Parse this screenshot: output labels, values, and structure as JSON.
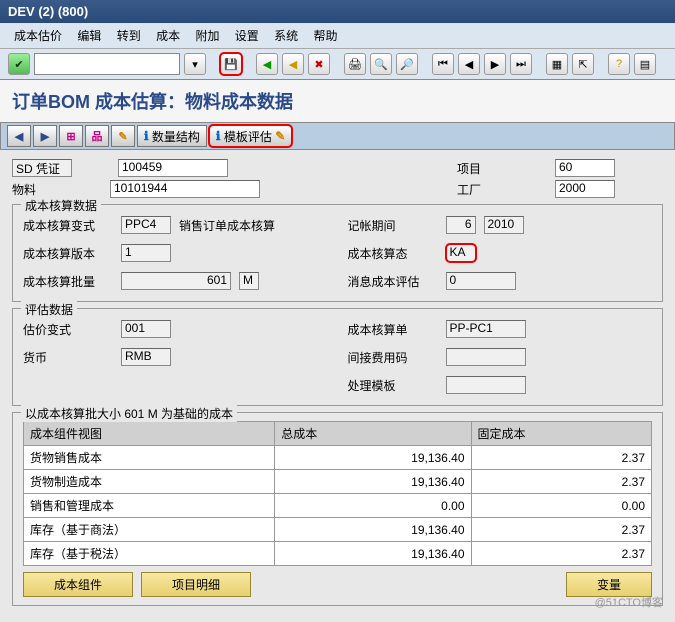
{
  "window_title": "DEV (2) (800)",
  "menu": [
    "成本估价",
    "编辑",
    "转到",
    "成本",
    "附加",
    "设置",
    "系统",
    "帮助"
  ],
  "page_title": "订单BOM 成本估算：物料成本数据",
  "app_toolbar": {
    "btn_qty": "数量结构",
    "btn_tpl": "模板评估"
  },
  "header": {
    "lbl_sd": "SD 凭证",
    "val_sd": "100459",
    "lbl_item": "项目",
    "val_item": "60",
    "lbl_mat": "物料",
    "val_mat": "10101944",
    "lbl_plant": "工厂",
    "val_plant": "2000"
  },
  "g1": {
    "title": "成本核算数据",
    "lbl_variant": "成本核算变式",
    "val_variant": "PPC4",
    "txt_variant": "销售订单成本核算",
    "lbl_period": "记帐期间",
    "val_period_m": "6",
    "val_period_y": "2010",
    "lbl_ver": "成本核算版本",
    "val_ver": "1",
    "lbl_status": "成本核算态",
    "val_status": "KA",
    "lbl_lot": "成本核算批量",
    "val_lot": "601",
    "val_lot_u": "M",
    "lbl_msg": "消息成本评估",
    "val_msg": "0"
  },
  "g2": {
    "title": "评估数据",
    "lbl_vv": "估价变式",
    "val_vv": "001",
    "lbl_unit": "成本核算单",
    "val_unit": "PP-PC1",
    "lbl_curr": "货币",
    "val_curr": "RMB",
    "lbl_oh": "间接费用码",
    "val_oh": "",
    "lbl_tmpl": "处理模板",
    "val_tmpl": ""
  },
  "g3": {
    "title": "以成本核算批大小 601 M 为基础的成本",
    "cols": [
      "成本组件视图",
      "总成本",
      "固定成本"
    ],
    "rows": [
      {
        "name": "货物销售成本",
        "total": "19,136.40",
        "fixed": "2.37"
      },
      {
        "name": "货物制造成本",
        "total": "19,136.40",
        "fixed": "2.37"
      },
      {
        "name": "销售和管理成本",
        "total": "0.00",
        "fixed": "0.00"
      },
      {
        "name": "库存（基于商法）",
        "total": "19,136.40",
        "fixed": "2.37"
      },
      {
        "name": "库存（基于税法）",
        "total": "19,136.40",
        "fixed": "2.37"
      }
    ],
    "btn_comp": "成本组件",
    "btn_item": "项目明细",
    "btn_var": "变量"
  },
  "chart_data": {
    "type": "table",
    "title": "以成本核算批大小 601 M 为基础的成本",
    "columns": [
      "成本组件视图",
      "总成本",
      "固定成本"
    ],
    "rows": [
      [
        "货物销售成本",
        19136.4,
        2.37
      ],
      [
        "货物制造成本",
        19136.4,
        2.37
      ],
      [
        "销售和管理成本",
        0.0,
        0.0
      ],
      [
        "库存（基于商法）",
        19136.4,
        2.37
      ],
      [
        "库存（基于税法）",
        19136.4,
        2.37
      ]
    ]
  },
  "watermark": "@51CTO博客"
}
